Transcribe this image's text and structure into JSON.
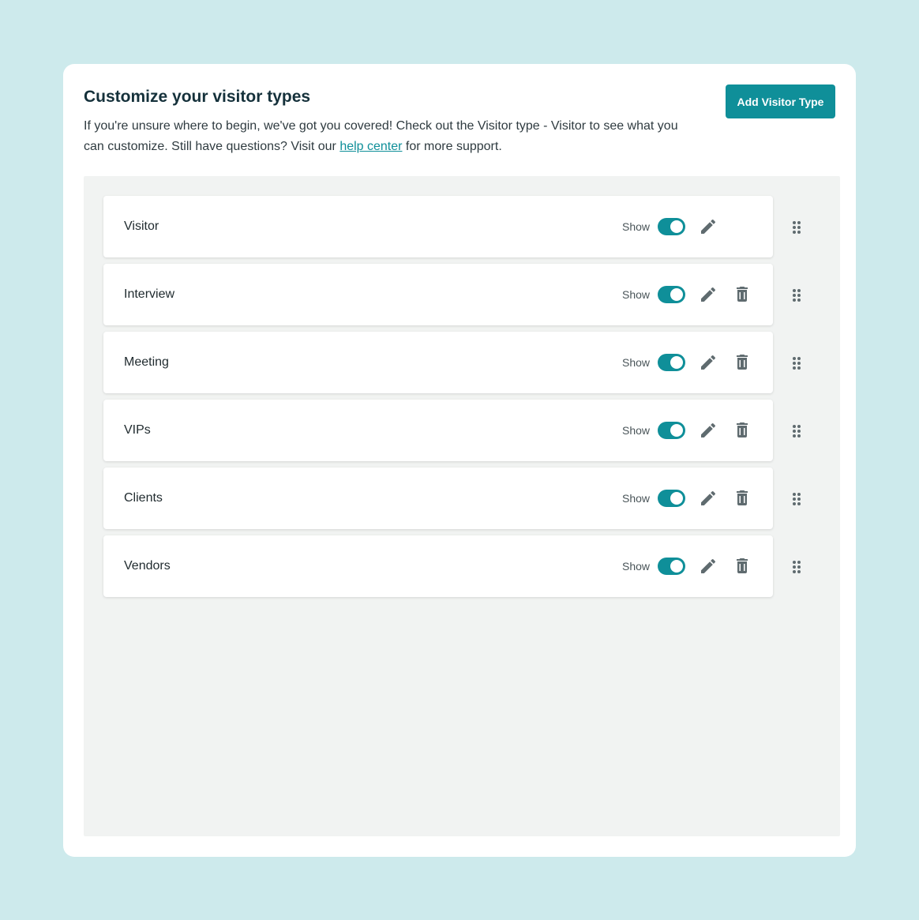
{
  "header": {
    "title": "Customize your visitor types",
    "desc_part1": "If you're unsure where to begin, we've got you covered! Check out the Visitor type - Visitor to see what you can customize. Still have questions? Visit our ",
    "help_link": "help center",
    "desc_part2": " for more support.",
    "add_button": "Add Visitor Type"
  },
  "colors": {
    "accent": "#0f8f99",
    "page_bg": "#cdeaec",
    "icon": "#5f6b6f"
  },
  "visitor_types": [
    {
      "label": "Visitor",
      "show_label": "Show",
      "shown": true,
      "deletable": false
    },
    {
      "label": "Interview",
      "show_label": "Show",
      "shown": true,
      "deletable": true
    },
    {
      "label": "Meeting",
      "show_label": "Show",
      "shown": true,
      "deletable": true
    },
    {
      "label": "VIPs",
      "show_label": "Show",
      "shown": true,
      "deletable": true
    },
    {
      "label": "Clients",
      "show_label": "Show",
      "shown": true,
      "deletable": true
    },
    {
      "label": "Vendors",
      "show_label": "Show",
      "shown": true,
      "deletable": true
    }
  ],
  "icons": {
    "edit": "pencil-icon",
    "delete": "trash-icon",
    "drag": "drag-handle-icon"
  }
}
